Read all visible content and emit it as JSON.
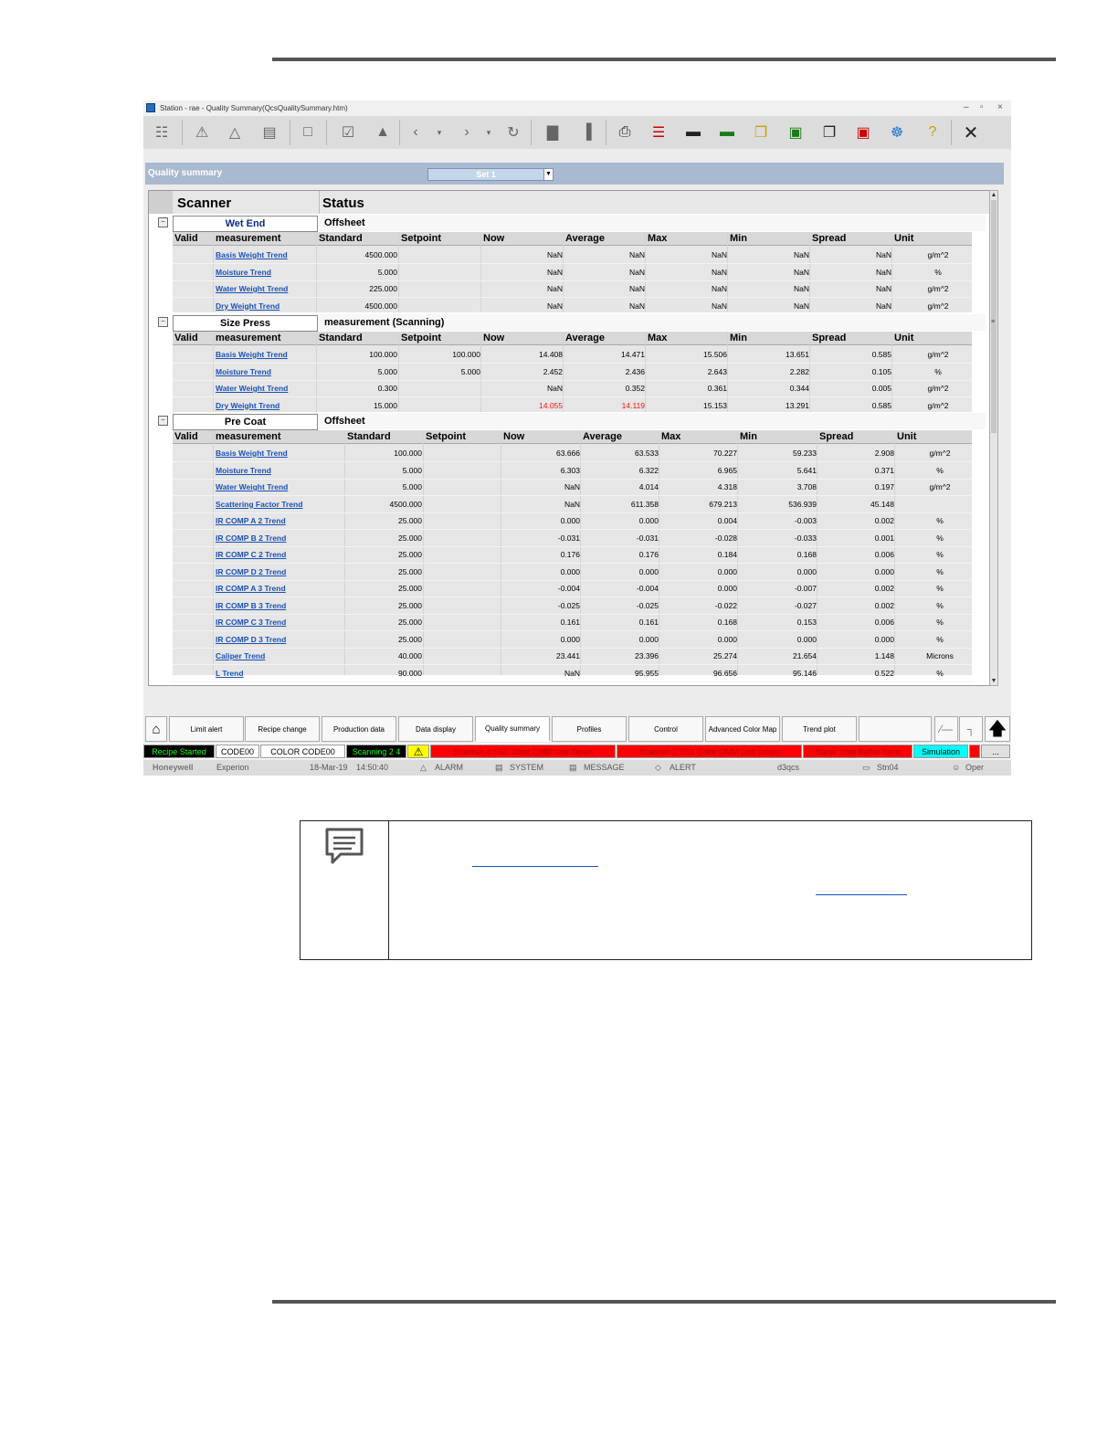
{
  "window": {
    "title": "Station - rae - Quality Summary(QcsQualitySummary.htm)",
    "controls": [
      "–",
      "▫",
      "×"
    ]
  },
  "quality_summary": {
    "label": "Quality summary",
    "set_value": "Set 1"
  },
  "grid": {
    "header": {
      "scanner": "Scanner",
      "status": "Status"
    },
    "sections": [
      {
        "name": "Wet End",
        "status": "Offsheet",
        "columns": [
          "Valid",
          "measurement",
          "Standard",
          "Setpoint",
          "Now",
          "Average",
          "Max",
          "Min",
          "Spread",
          "Unit"
        ],
        "rows": [
          {
            "m": "Basis Weight Trend",
            "std": "4500.000",
            "sp": "",
            "now": "NaN",
            "avg": "NaN",
            "max": "NaN",
            "min": "NaN",
            "spread": "NaN",
            "unit": "g/m^2"
          },
          {
            "m": "Moisture Trend",
            "std": "5.000",
            "sp": "",
            "now": "NaN",
            "avg": "NaN",
            "max": "NaN",
            "min": "NaN",
            "spread": "NaN",
            "unit": "%"
          },
          {
            "m": "Water Weight Trend",
            "std": "225.000",
            "sp": "",
            "now": "NaN",
            "avg": "NaN",
            "max": "NaN",
            "min": "NaN",
            "spread": "NaN",
            "unit": "g/m^2"
          },
          {
            "m": "Dry Weight Trend",
            "std": "4500.000",
            "sp": "",
            "now": "NaN",
            "avg": "NaN",
            "max": "NaN",
            "min": "NaN",
            "spread": "NaN",
            "unit": "g/m^2"
          }
        ]
      },
      {
        "name": "Size Press",
        "status": "measurement (Scanning)",
        "columns": [
          "Valid",
          "measurement",
          "Standard",
          "Setpoint",
          "Now",
          "Average",
          "Max",
          "Min",
          "Spread",
          "Unit"
        ],
        "rows": [
          {
            "m": "Basis Weight Trend",
            "std": "100.000",
            "sp": "100.000",
            "now": "14.408",
            "avg": "14.471",
            "max": "15.506",
            "min": "13.651",
            "spread": "0.585",
            "unit": "g/m^2"
          },
          {
            "m": "Moisture Trend",
            "std": "5.000",
            "sp": "5.000",
            "now": "2.452",
            "avg": "2.436",
            "max": "2.643",
            "min": "2.282",
            "spread": "0.105",
            "unit": "%"
          },
          {
            "m": "Water Weight Trend",
            "std": "0.300",
            "sp": "",
            "now": "NaN",
            "avg": "0.352",
            "max": "0.361",
            "min": "0.344",
            "spread": "0.005",
            "unit": "g/m^2"
          },
          {
            "m": "Dry Weight Trend",
            "std": "15.000",
            "sp": "",
            "now": "14.055",
            "avg": "14.119",
            "max": "15.153",
            "min": "13.291",
            "spread": "0.585",
            "unit": "g/m^2",
            "alarm": true
          }
        ]
      },
      {
        "name": "Pre Coat",
        "status": "Offsheet",
        "columns": [
          "Valid",
          "measurement",
          "Standard",
          "Setpoint",
          "Now",
          "Average",
          "Max",
          "Min",
          "Spread",
          "Unit"
        ],
        "rows": [
          {
            "m": "Basis Weight Trend",
            "std": "100.000",
            "sp": "",
            "now": "63.666",
            "avg": "63.533",
            "max": "70.227",
            "min": "59.233",
            "spread": "2.908",
            "unit": "g/m^2"
          },
          {
            "m": "Moisture Trend",
            "std": "5.000",
            "sp": "",
            "now": "6.303",
            "avg": "6.322",
            "max": "6.965",
            "min": "5.641",
            "spread": "0.371",
            "unit": "%"
          },
          {
            "m": "Water Weight Trend",
            "std": "5.000",
            "sp": "",
            "now": "NaN",
            "avg": "4.014",
            "max": "4.318",
            "min": "3.708",
            "spread": "0.197",
            "unit": "g/m^2"
          },
          {
            "m": "Scattering Factor Trend",
            "std": "4500.000",
            "sp": "",
            "now": "NaN",
            "avg": "611.358",
            "max": "679.213",
            "min": "536.939",
            "spread": "45.148",
            "unit": ""
          },
          {
            "m": "IR COMP A 2 Trend",
            "std": "25.000",
            "sp": "",
            "now": "0.000",
            "avg": "0.000",
            "max": "0.004",
            "min": "-0.003",
            "spread": "0.002",
            "unit": "%"
          },
          {
            "m": "IR COMP B 2 Trend",
            "std": "25.000",
            "sp": "",
            "now": "-0.031",
            "avg": "-0.031",
            "max": "-0.028",
            "min": "-0.033",
            "spread": "0.001",
            "unit": "%"
          },
          {
            "m": "IR COMP C 2 Trend",
            "std": "25.000",
            "sp": "",
            "now": "0.176",
            "avg": "0.176",
            "max": "0.184",
            "min": "0.168",
            "spread": "0.006",
            "unit": "%"
          },
          {
            "m": "IR COMP D 2 Trend",
            "std": "25.000",
            "sp": "",
            "now": "0.000",
            "avg": "0.000",
            "max": "0.000",
            "min": "0.000",
            "spread": "0.000",
            "unit": "%"
          },
          {
            "m": "IR COMP A 3 Trend",
            "std": "25.000",
            "sp": "",
            "now": "-0.004",
            "avg": "-0.004",
            "max": "0.000",
            "min": "-0.007",
            "spread": "0.002",
            "unit": "%"
          },
          {
            "m": "IR COMP B 3 Trend",
            "std": "25.000",
            "sp": "",
            "now": "-0.025",
            "avg": "-0.025",
            "max": "-0.022",
            "min": "-0.027",
            "spread": "0.002",
            "unit": "%"
          },
          {
            "m": "IR COMP C 3 Trend",
            "std": "25.000",
            "sp": "",
            "now": "0.161",
            "avg": "0.161",
            "max": "0.168",
            "min": "0.153",
            "spread": "0.006",
            "unit": "%"
          },
          {
            "m": "IR COMP D 3 Trend",
            "std": "25.000",
            "sp": "",
            "now": "0.000",
            "avg": "0.000",
            "max": "0.000",
            "min": "0.000",
            "spread": "0.000",
            "unit": "%"
          },
          {
            "m": "Caliper Trend",
            "std": "40.000",
            "sp": "",
            "now": "23.441",
            "avg": "23.396",
            "max": "25.274",
            "min": "21.654",
            "spread": "1.148",
            "unit": "Microns"
          },
          {
            "m": "L Trend",
            "std": "90.000",
            "sp": "",
            "now": "NaN",
            "avg": "95.955",
            "max": "96.656",
            "min": "95.146",
            "spread": "0.522",
            "unit": "%"
          }
        ]
      }
    ]
  },
  "nav": {
    "home_icon": "home-icon",
    "buttons": [
      "Limit alert",
      "Recipe change",
      "Production data",
      "Data display",
      "Quality summary",
      "Profiles",
      "Control",
      "Advanced Color Map",
      "Trend plot",
      ""
    ],
    "up_icon": "arrow-up-icon"
  },
  "status_bar": [
    {
      "text": "Recipe Started",
      "bg": "#000000",
      "fg": "#19ff19"
    },
    {
      "text": "CODE00",
      "bg": "#ffffff",
      "fg": "#000000"
    },
    {
      "text": "COLOR CODE00",
      "bg": "#ffffff",
      "fg": "#000000"
    },
    {
      "text": "Scanning 2 4",
      "bg": "#000000",
      "fg": "#19ff19"
    },
    {
      "text": "",
      "bg": "#ffff00",
      "fg": "#000000",
      "icon": "warning-icon"
    },
    {
      "text": "Scanner 4 SS1 Color CMM Link Down",
      "bg": "#ff0000",
      "fg": "#b00000"
    },
    {
      "text": "Scanner 3 SS1 Color CMM Link Down",
      "bg": "#ff0000",
      "fg": "#b00000"
    },
    {
      "text": "Same Spot Buffer Error",
      "bg": "#ff0000",
      "fg": "#b00000"
    },
    {
      "text": "Simulation",
      "bg": "#00ffff",
      "fg": "#000000"
    },
    {
      "text": "",
      "bg": "#ff0000",
      "fg": "#000000"
    },
    {
      "text": "...",
      "bg": "#e0e0e0",
      "fg": "#000000"
    }
  ],
  "footer": {
    "brand": "Honeywell",
    "app": "Experion",
    "date": "18-Mar-19",
    "time": "14:50:40",
    "alarm": "ALARM",
    "system": "SYSTEM",
    "message": "MESSAGE",
    "alert": "ALERT",
    "node": "d3qcs",
    "station": "Stn04",
    "user": "Oper"
  },
  "note": {
    "icon": "note-icon"
  },
  "colors": {
    "link": "#1a52b8",
    "header_band": "#a9b9cf",
    "alarm_red": "#ff1010"
  }
}
